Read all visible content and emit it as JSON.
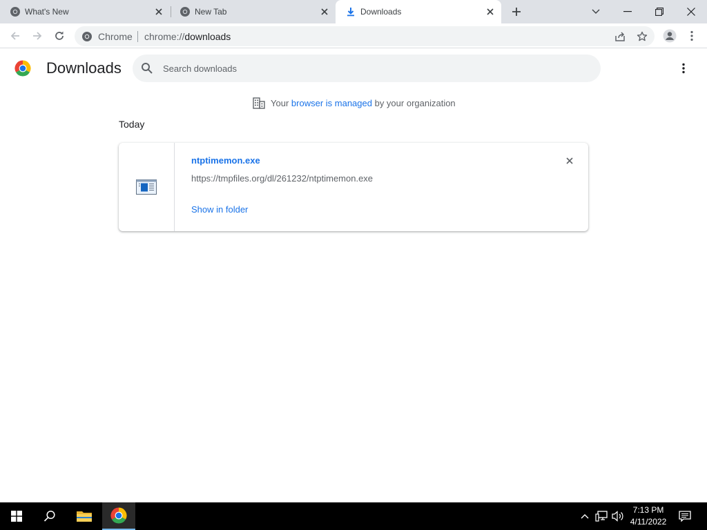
{
  "tabs": [
    {
      "label": "What's New",
      "icon": "chrome-icon"
    },
    {
      "label": "New Tab",
      "icon": "chrome-icon"
    },
    {
      "label": "Downloads",
      "icon": "download-icon"
    }
  ],
  "window_controls": [
    "tab-search-icon",
    "minimize-icon",
    "restore-icon",
    "close-icon"
  ],
  "omnibox": {
    "site_chip": "Chrome",
    "url_scheme": "chrome://",
    "url_host": "downloads"
  },
  "page": {
    "title": "Downloads",
    "search_placeholder": "Search downloads",
    "managed_prefix": "Your",
    "managed_link": "browser is managed",
    "managed_suffix": "by your organization",
    "section_date": "Today"
  },
  "download": {
    "file_name": "ntptimemon.exe",
    "url": "https://tmpfiles.org/dl/261232/ntptimemon.exe",
    "action": "Show in folder"
  },
  "taskbar": {
    "time": "7:13 PM",
    "date": "4/11/2022"
  },
  "colors": {
    "accent": "#1a73e8",
    "tabstrip": "#dee1e6",
    "omnibox": "#f1f3f4",
    "taskbar": "#000000"
  }
}
